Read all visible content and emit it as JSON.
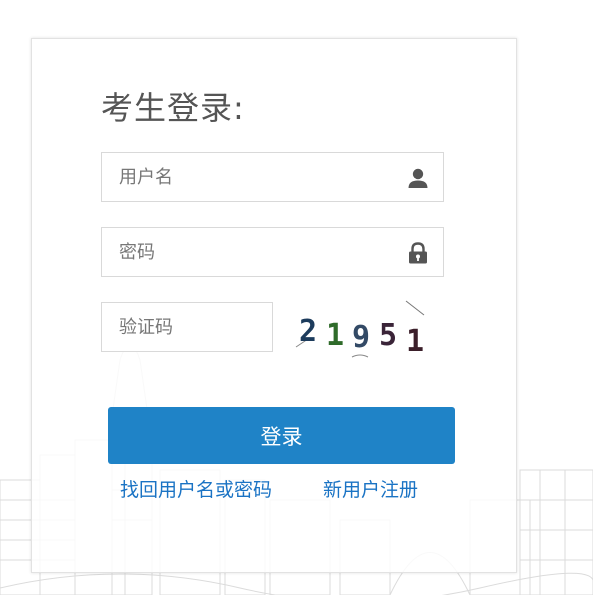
{
  "login": {
    "title": "考生登录:",
    "username": {
      "placeholder": "用户名",
      "icon": "user-icon"
    },
    "password": {
      "placeholder": "密码",
      "icon": "lock-icon"
    },
    "captcha": {
      "placeholder": "验证码",
      "image_text": "21951"
    },
    "submit_label": "登录",
    "links": {
      "recover": "找回用户名或密码",
      "register": "新用户注册"
    }
  },
  "colors": {
    "primary_button": "#1f83c7",
    "link": "#1a73c4",
    "border": "#d9d9d9",
    "title": "#555555"
  }
}
